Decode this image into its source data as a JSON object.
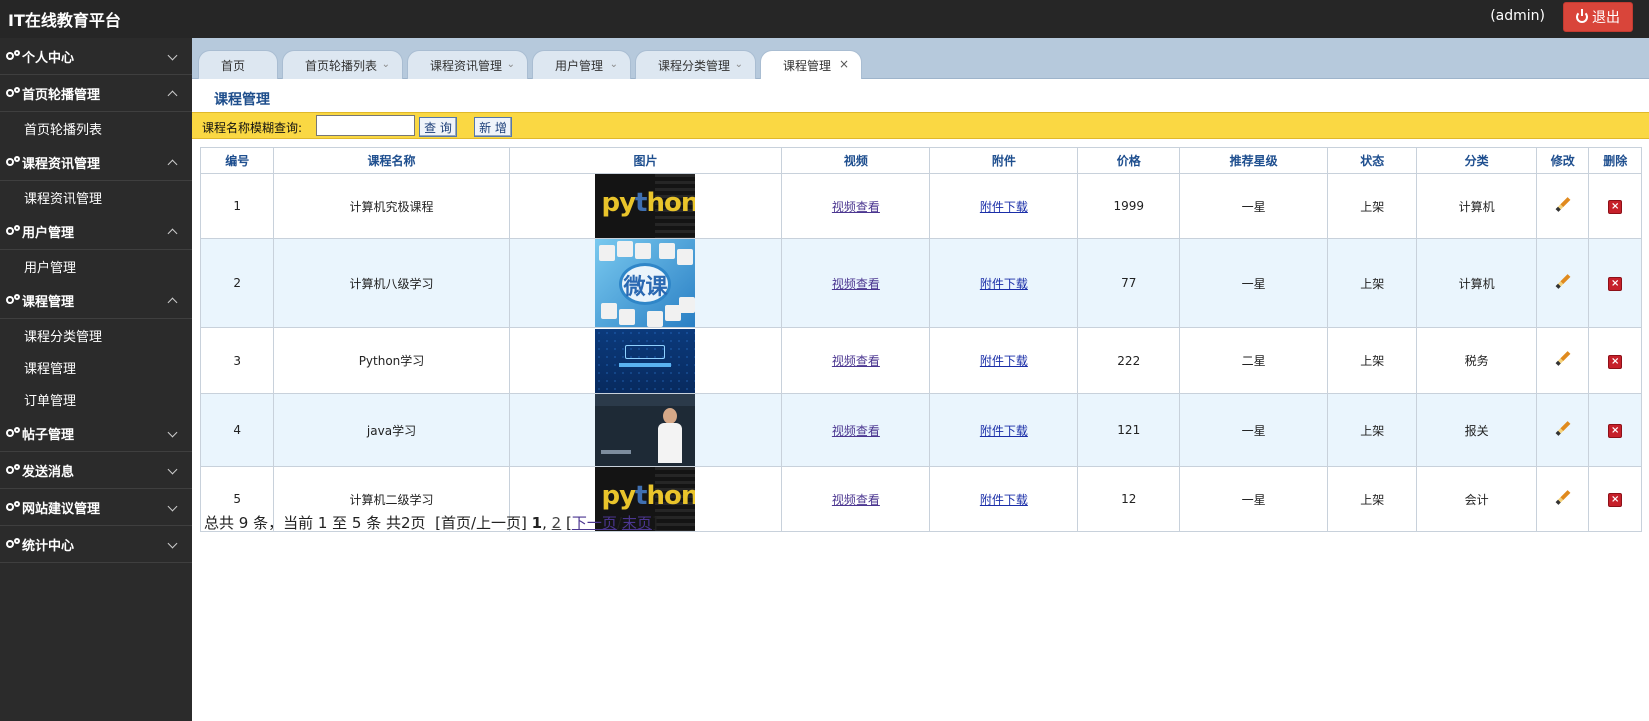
{
  "header": {
    "title": "IT在线教育平台",
    "user": "(admin)",
    "logout_label": "退出"
  },
  "sidebar": {
    "groups": [
      {
        "label": "个人中心",
        "expanded": false,
        "items": []
      },
      {
        "label": "首页轮播管理",
        "expanded": true,
        "items": [
          "首页轮播列表"
        ]
      },
      {
        "label": "课程资讯管理",
        "expanded": true,
        "items": [
          "课程资讯管理"
        ]
      },
      {
        "label": "用户管理",
        "expanded": true,
        "items": [
          "用户管理"
        ]
      },
      {
        "label": "课程管理",
        "expanded": true,
        "items": [
          "课程分类管理",
          "课程管理",
          "订单管理"
        ]
      },
      {
        "label": "帖子管理",
        "expanded": false,
        "items": []
      },
      {
        "label": "发送消息",
        "expanded": false,
        "items": []
      },
      {
        "label": "网站建议管理",
        "expanded": false,
        "items": []
      },
      {
        "label": "统计中心",
        "expanded": false,
        "items": []
      }
    ]
  },
  "tabs": [
    {
      "label": "首页",
      "closable": false,
      "active": false
    },
    {
      "label": "首页轮播列表",
      "closable": true,
      "active": false
    },
    {
      "label": "课程资讯管理",
      "closable": true,
      "active": false
    },
    {
      "label": "用户管理",
      "closable": true,
      "active": false
    },
    {
      "label": "课程分类管理",
      "closable": true,
      "active": false
    },
    {
      "label": "课程管理",
      "closable": true,
      "active": true
    }
  ],
  "page": {
    "title": "课程管理",
    "search": {
      "label": "课程名称模糊查询:",
      "value": "",
      "query_label": "查 询",
      "add_label": "新 增"
    }
  },
  "table": {
    "headers": [
      "编号",
      "课程名称",
      "图片",
      "视频",
      "附件",
      "价格",
      "推荐星级",
      "状态",
      "分类",
      "修改",
      "删除"
    ],
    "rows": [
      {
        "id": "1",
        "name": "计算机究极课程",
        "image": "python",
        "video": "视频查看",
        "attachment": "附件下载",
        "price": "1999",
        "stars": "一星",
        "status": "上架",
        "category": "计算机"
      },
      {
        "id": "2",
        "name": "计算机八级学习",
        "image": "weike",
        "video": "视频查看",
        "attachment": "附件下载",
        "price": "77",
        "stars": "一星",
        "status": "上架",
        "category": "计算机"
      },
      {
        "id": "3",
        "name": "Python学习",
        "image": "jisuanji",
        "video": "视频查看",
        "attachment": "附件下载",
        "price": "222",
        "stars": "二星",
        "status": "上架",
        "category": "税务"
      },
      {
        "id": "4",
        "name": "java学习",
        "image": "lecture",
        "video": "视频查看",
        "attachment": "附件下载",
        "price": "121",
        "stars": "一星",
        "status": "上架",
        "category": "报关"
      },
      {
        "id": "5",
        "name": "计算机二级学习",
        "image": "python",
        "video": "视频查看",
        "attachment": "附件下载",
        "price": "12",
        "stars": "一星",
        "status": "上架",
        "category": "会计"
      }
    ]
  },
  "pager": {
    "summary": "总共 9 条，当前 1 至 5 条 共2页",
    "first_prev": "[首页/上一页]",
    "current": "1",
    "sep": ",",
    "page2": "2",
    "next": "下一页",
    "last": "末页"
  }
}
